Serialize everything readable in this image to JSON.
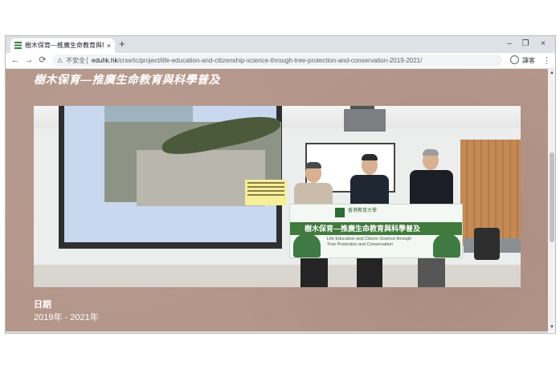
{
  "tab": {
    "title": "樹木保育—推廣生命教育與科學普",
    "close": "×",
    "new_tab": "+"
  },
  "window_controls": {
    "minimize": "–",
    "maximize": "❐",
    "close": "×"
  },
  "toolbar": {
    "back": "←",
    "forward": "→",
    "reload": "⟳",
    "security_warning": "⚠",
    "security_text": "不安全",
    "url_host": "eduhk.hk",
    "url_path": "/crse/tc/project/life-education-and-citizenship-science-through-tree-protection-and-conservation-2019-2021/",
    "translate": "譯客",
    "menu": "⋮"
  },
  "page": {
    "title": "樹木保育—推廣生命教育與科學普及",
    "date_label": "日期",
    "date_value": "2019年 - 2021年"
  },
  "photo": {
    "banner_title": "樹木保育—推廣生命教育與科學普及",
    "banner_logo_text": "香港教育大學",
    "banner_sub1": "Life Education and Citizen Science through",
    "banner_sub2": "Tree Protection and Conservation"
  },
  "icons": {
    "favicon": "eduhk-favicon-icon",
    "warning": "warning-icon",
    "account": "account-icon"
  },
  "colors": {
    "page_bg": "#b4968a",
    "banner_green": "#417a3d"
  }
}
